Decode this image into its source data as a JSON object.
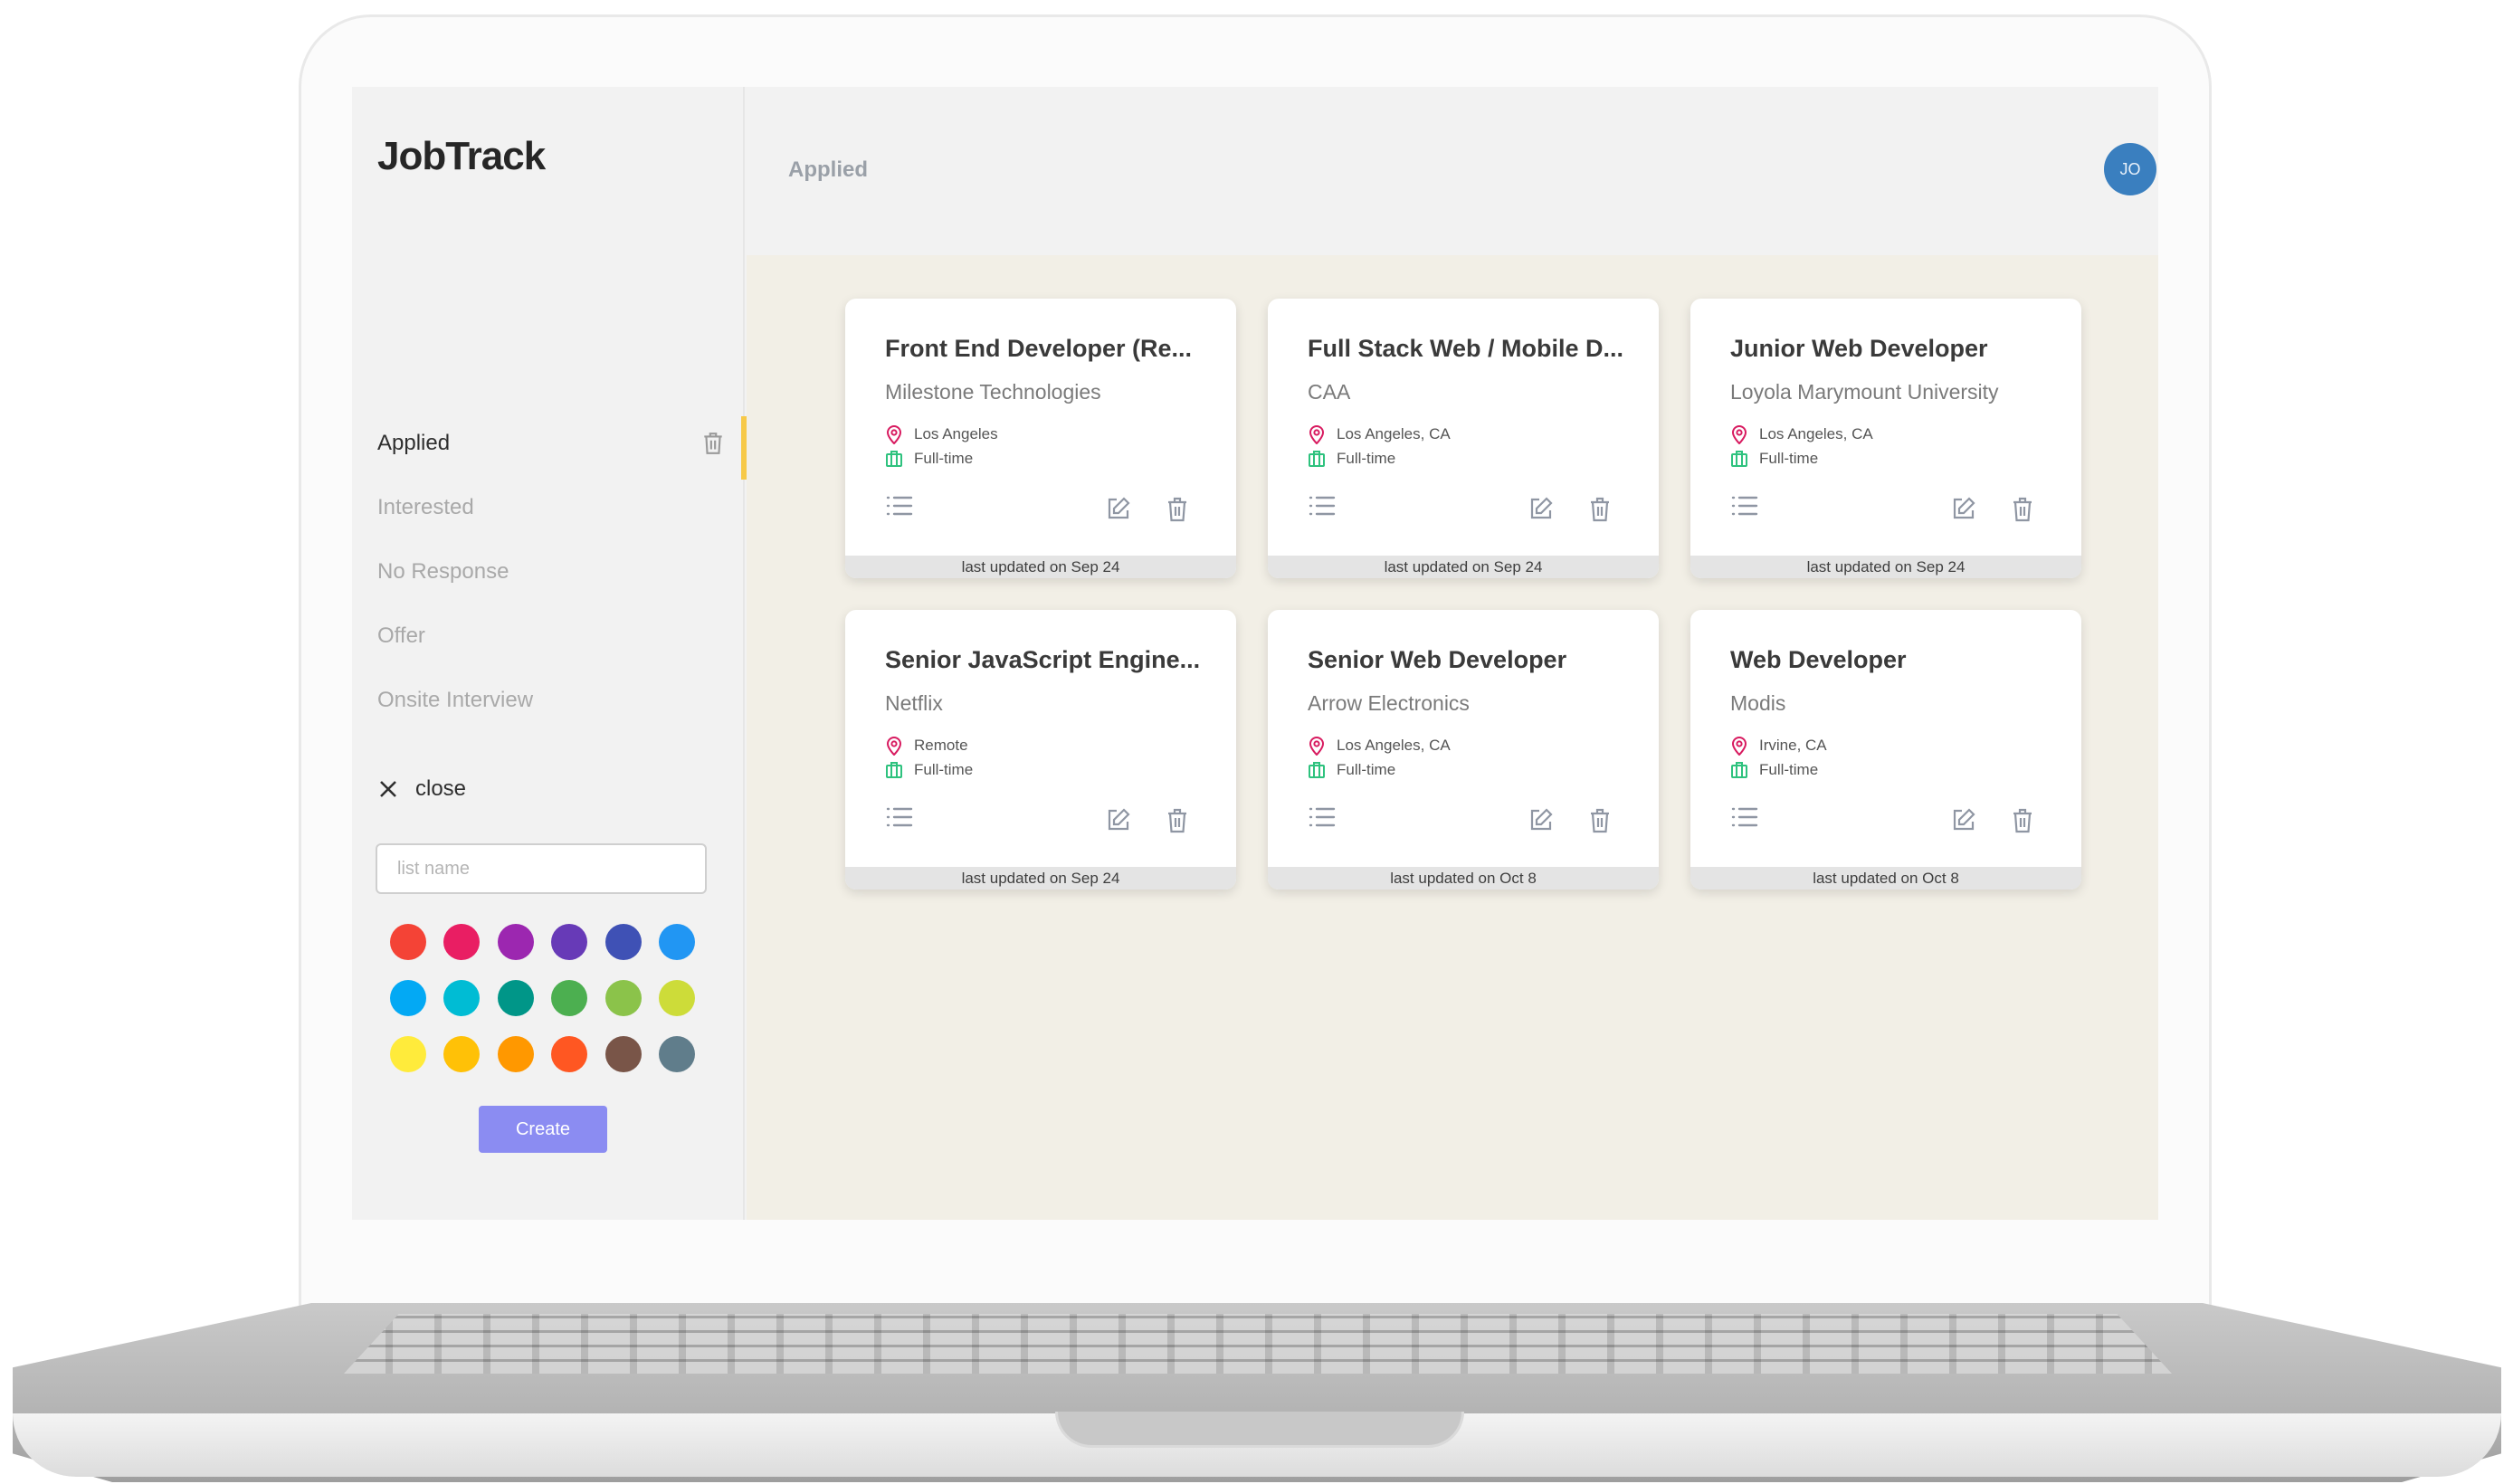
{
  "app": {
    "logo": "JobTrack"
  },
  "sidebar": {
    "lists": [
      {
        "label": "Applied",
        "active": true
      },
      {
        "label": "Interested",
        "active": false
      },
      {
        "label": "No Response",
        "active": false
      },
      {
        "label": "Offer",
        "active": false
      },
      {
        "label": "Onsite Interview",
        "active": false
      }
    ],
    "close_label": "close",
    "list_name_placeholder": "list name",
    "create_label": "Create",
    "accent_color": "#f7c948",
    "swatches": [
      "#f44336",
      "#e91e63",
      "#9c27b0",
      "#673ab7",
      "#3f51b5",
      "#2196f3",
      "#03a9f4",
      "#00bcd4",
      "#009688",
      "#4caf50",
      "#8bc34a",
      "#cddc39",
      "#ffeb3b",
      "#ffc107",
      "#ff9800",
      "#ff5722",
      "#795548",
      "#607d8b"
    ]
  },
  "header": {
    "title": "Applied",
    "avatar_initials": "JO",
    "avatar_color": "#3a7fbf"
  },
  "cards": [
    {
      "title": "Front End Developer (Re...",
      "company": "Milestone Technologies",
      "location": "Los Angeles",
      "type": "Full-time",
      "updated": "last updated on Sep 24"
    },
    {
      "title": "Full Stack Web / Mobile D...",
      "company": "CAA",
      "location": "Los Angeles, CA",
      "type": "Full-time",
      "updated": "last updated on Sep 24"
    },
    {
      "title": "Junior Web Developer",
      "company": "Loyola Marymount University",
      "location": "Los Angeles, CA",
      "type": "Full-time",
      "updated": "last updated on Sep 24"
    },
    {
      "title": "Senior JavaScript Engine...",
      "company": "Netflix",
      "location": "Remote",
      "type": "Full-time",
      "updated": "last updated on Sep 24"
    },
    {
      "title": "Senior Web Developer",
      "company": "Arrow Electronics",
      "location": "Los Angeles, CA",
      "type": "Full-time",
      "updated": "last updated on Oct 8"
    },
    {
      "title": "Web Developer",
      "company": "Modis",
      "location": "Irvine, CA",
      "type": "Full-time",
      "updated": "last updated on Oct 8"
    }
  ],
  "icons": {
    "location": "map-pin-icon",
    "job_type": "briefcase-icon",
    "notes": "list-icon",
    "edit": "edit-icon",
    "delete": "trash-icon",
    "add": "plus-icon"
  }
}
